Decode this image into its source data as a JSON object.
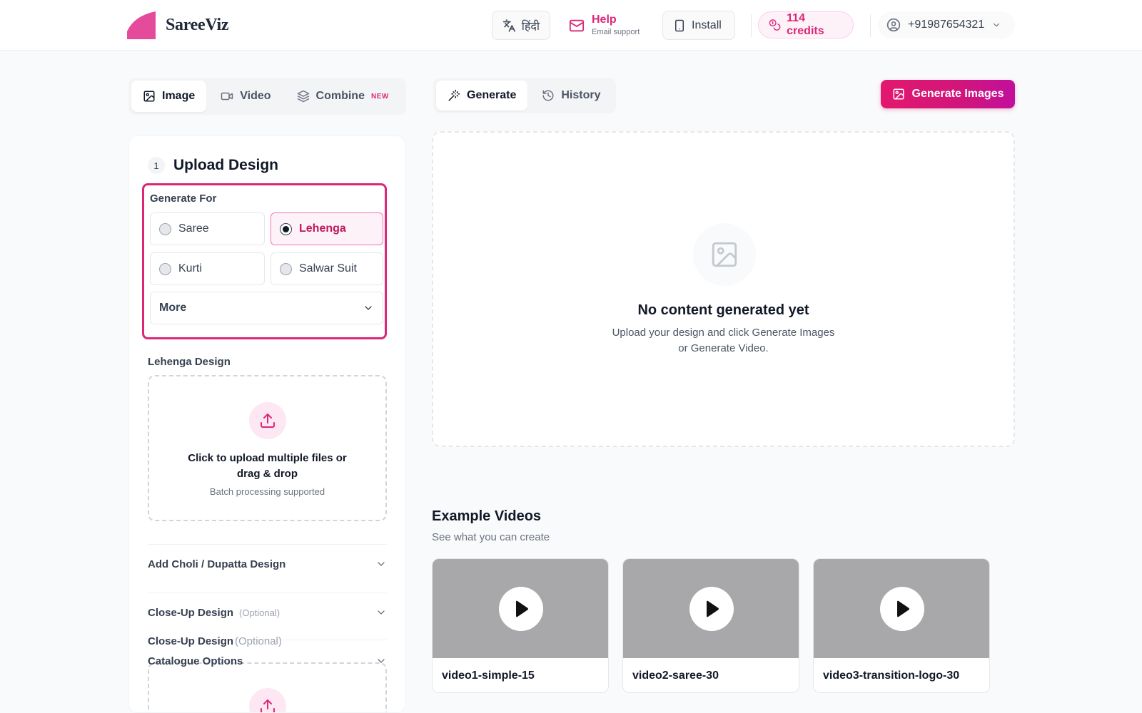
{
  "brand": {
    "name": "SareeViz",
    "color": "#db2777"
  },
  "header": {
    "language_label": "हिंदी",
    "help_title": "Help",
    "help_sub": "Email support",
    "install_label": "Install",
    "credits_label": "114 credits",
    "phone": "+91987654321"
  },
  "mode_tabs": [
    {
      "label": "Image",
      "active": true
    },
    {
      "label": "Video",
      "active": false
    },
    {
      "label": "Combine",
      "badge": "NEW",
      "active": false
    }
  ],
  "view_tabs": [
    {
      "label": "Generate",
      "active": true
    },
    {
      "label": "History",
      "active": false
    }
  ],
  "generate_button": "Generate Images",
  "upload": {
    "step_number": "1",
    "step_title": "Upload Design",
    "generate_for_label": "Generate For",
    "options": [
      {
        "label": "Saree",
        "selected": false
      },
      {
        "label": "Lehenga",
        "selected": true
      },
      {
        "label": "Kurti",
        "selected": false
      },
      {
        "label": "Salwar Suit",
        "selected": false
      }
    ],
    "more_label": "More",
    "design_label": "Lehenga Design",
    "dropzone_title": "Click to upload multiple files or drag & drop",
    "dropzone_sub": "Batch processing supported",
    "choli_label": "Add Choli / Dupatta Design",
    "closeup_label": "Close-Up Design",
    "optional_label": "(Optional)",
    "closeup_label_2": "Close-Up Design",
    "optional_label_2": "(Optional)",
    "catalogue_label": "Catalogue Options"
  },
  "empty_state": {
    "title": "No content generated yet",
    "subtitle": "Upload your design and click Generate Images or Generate Video."
  },
  "examples": {
    "title": "Example Videos",
    "subtitle": "See what you can create",
    "videos": [
      {
        "name": "video1-simple-15"
      },
      {
        "name": "video2-saree-30"
      },
      {
        "name": "video3-transition-logo-30"
      }
    ]
  }
}
